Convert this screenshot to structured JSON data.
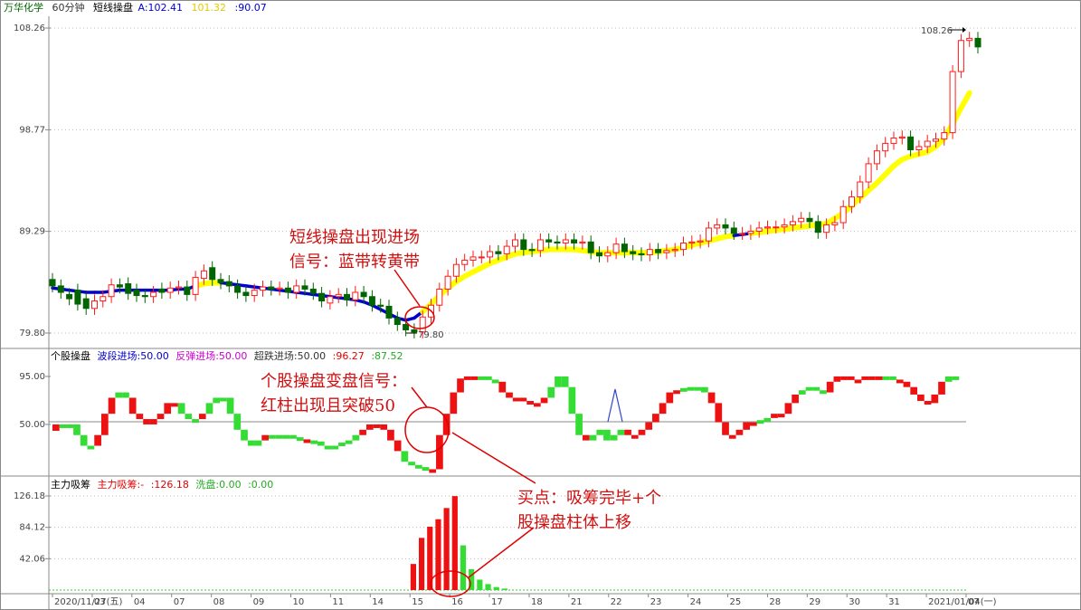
{
  "header": {
    "stock": "万华化学",
    "period": "60分钟",
    "indicator": "短线操盘",
    "a_label": "A:102.41",
    "b_label": "101.32",
    "c_label": ":90.07"
  },
  "panel2_header": {
    "title": "个股操盘",
    "bd": "波段进场:50.00",
    "ft": "反弹进场:50.00",
    "cd": "超跌进场:50.00",
    "v1": ":96.27",
    "v2": ":87.52"
  },
  "panel3_header": {
    "title": "主力吸筹",
    "m1": "主力吸筹:-",
    "m2": ":126.18",
    "wash": "洗盘:0.00",
    "m3": ":0.00"
  },
  "annotations": {
    "a1_line1": "短线操盘出现进场",
    "a1_line2": "信号：蓝带转黄带",
    "a2_line1": "个股操盘变盘信号：",
    "a2_line2": "红柱出现且突破50",
    "a3_line1": "买点：吸筹完毕+个",
    "a3_line2": "股操盘柱体上移"
  },
  "price_markers": {
    "high": "108.26",
    "low": "79.80"
  },
  "colors": {
    "up": "#ff1a1a",
    "down": "#006400",
    "band_up": "#ffff00",
    "band_down": "#0000cc",
    "green_bar": "#33cc33"
  },
  "chart_data": [
    {
      "type": "candlestick",
      "y_ticks": [
        "108.26",
        "98.77",
        "89.29",
        "79.80"
      ],
      "ylim": [
        79.8,
        108.26
      ],
      "x_labels": [
        "2020/11/27(五)",
        "03",
        "04",
        "07",
        "08",
        "09",
        "10",
        "11",
        "14",
        "15",
        "16",
        "17",
        "18",
        "21",
        "22",
        "23",
        "24",
        "25",
        "28",
        "29",
        "30",
        "31",
        "2021/01/04(一)",
        "07"
      ],
      "close": [
        84.2,
        83.6,
        83,
        82.5,
        82.1,
        82.8,
        83.2,
        84.3,
        84.1,
        83.5,
        83.3,
        83.2,
        83.6,
        83.6,
        84,
        84.1,
        83.4,
        85,
        85.6,
        84.8,
        84.5,
        84.2,
        83.6,
        83.3,
        83.8,
        84.1,
        83.9,
        84,
        83.6,
        84.2,
        83.9,
        83.5,
        82.8,
        83.2,
        83.4,
        82.9,
        83.6,
        83.2,
        82.4,
        82.3,
        81.2,
        80.6,
        80.1,
        79.9,
        81.3,
        82.4,
        83.9,
        85.1,
        86.2,
        86.6,
        86.9,
        86.9,
        87.4,
        87.2,
        87.9,
        88.5,
        87.6,
        87.5,
        88.5,
        88.3,
        88.2,
        88.5,
        88.2,
        88.3,
        87.3,
        87.0,
        87.3,
        88.1,
        87.4,
        87.2,
        87.1,
        87.6,
        87.3,
        87.5,
        87.6,
        88.2,
        88.3,
        88.4,
        89.6,
        89.9,
        89.6,
        89.1,
        89.1,
        89.3,
        89.6,
        89.7,
        89.7,
        89.9,
        90.2,
        90.5,
        90.2,
        89.2,
        89.9,
        90.1,
        91.6,
        92.5,
        93.9,
        95.6,
        96.8,
        97.5,
        98.0,
        98.1,
        96.9,
        97.2,
        97.7,
        97.9,
        98.5,
        104.2,
        107.1,
        107.3,
        106.5
      ],
      "open": [
        84.8,
        84.2,
        83.4,
        83.8,
        83,
        82.1,
        82.8,
        83.2,
        84.3,
        84.4,
        83.8,
        83.3,
        83.2,
        83.9,
        83.6,
        84,
        84.1,
        83.4,
        84.9,
        85.9,
        84.8,
        84.6,
        84.2,
        83.6,
        83.3,
        83.8,
        84.1,
        83.9,
        84,
        83.6,
        84.2,
        83.9,
        83.5,
        82.6,
        83.2,
        83.4,
        82.9,
        83.6,
        83.2,
        82.4,
        82.3,
        81.2,
        80.6,
        80.1,
        79.9,
        81.3,
        82.4,
        83.9,
        85.1,
        86.2,
        86.6,
        86.9,
        86.9,
        87.4,
        87.2,
        87.9,
        88.5,
        87.6,
        87.5,
        88.5,
        88.3,
        88.2,
        88.5,
        88.2,
        88.3,
        87.3,
        87.0,
        87.3,
        88.1,
        87.4,
        87.2,
        87.1,
        87.6,
        87.3,
        87.5,
        87.6,
        88.2,
        88.3,
        88.4,
        89.6,
        89.9,
        89.6,
        89.1,
        89.1,
        89.3,
        89.6,
        89.7,
        89.7,
        89.9,
        90.2,
        90.5,
        90.2,
        89.2,
        89.9,
        90.1,
        91.6,
        92.5,
        93.9,
        95.6,
        96.8,
        97.5,
        98.0,
        98.1,
        96.9,
        97.2,
        97.7,
        97.9,
        98.5,
        104.2,
        107.1,
        107.3
      ],
      "band": [
        84,
        83.9,
        83.8,
        83.7,
        83.6,
        83.6,
        83.6,
        83.7,
        83.8,
        83.8,
        83.8,
        83.8,
        83.8,
        83.8,
        83.8,
        83.9,
        83.9,
        84.2,
        84.4,
        84.5,
        84.5,
        84.4,
        84.3,
        84.2,
        84.1,
        84.0,
        83.9,
        83.8,
        83.7,
        83.6,
        83.5,
        83.4,
        83.3,
        83.2,
        83.1,
        83.0,
        82.9,
        82.7,
        82.4,
        82.0,
        81.6,
        81.2,
        81.0,
        81.2,
        81.8,
        82.5,
        83.3,
        84.0,
        84.6,
        85.1,
        85.5,
        85.9,
        86.3,
        86.6,
        86.9,
        87.2,
        87.3,
        87.4,
        87.5,
        87.6,
        87.6,
        87.6,
        87.6,
        87.5,
        87.4,
        87.3,
        87.3,
        87.3,
        87.3,
        87.3,
        87.3,
        87.3,
        87.4,
        87.5,
        87.6,
        87.8,
        88.0,
        88.2,
        88.4,
        88.6,
        88.8,
        88.9,
        89.0,
        89.1,
        89.2,
        89.3,
        89.4,
        89.5,
        89.6,
        89.7,
        89.8,
        89.9,
        90.0,
        90.5,
        91.0,
        91.7,
        92.4,
        93.1,
        93.8,
        94.6,
        95.4,
        96.0,
        96.3,
        96.5,
        96.7,
        97.2,
        98.0,
        99.3,
        100.8,
        102.2
      ],
      "band_color": [
        "d",
        "d",
        "d",
        "d",
        "d",
        "d",
        "d",
        "d",
        "d",
        "d",
        "d",
        "d",
        "d",
        "d",
        "d",
        "d",
        "d",
        "u",
        "u",
        "u",
        "d",
        "d",
        "d",
        "d",
        "d",
        "d",
        "d",
        "d",
        "d",
        "d",
        "d",
        "d",
        "d",
        "d",
        "d",
        "d",
        "d",
        "d",
        "d",
        "d",
        "d",
        "d",
        "d",
        "d",
        "u",
        "u",
        "u",
        "u",
        "u",
        "u",
        "u",
        "u",
        "u",
        "u",
        "u",
        "u",
        "u",
        "u",
        "u",
        "u",
        "u",
        "u",
        "u",
        "u",
        "u",
        "u",
        "u",
        "u",
        "u",
        "u",
        "u",
        "u",
        "u",
        "u",
        "u",
        "u",
        "u",
        "u",
        "u",
        "u",
        "u",
        "d",
        "d",
        "u",
        "u",
        "u",
        "u",
        "u",
        "u",
        "u",
        "u",
        "u",
        "u",
        "u",
        "u",
        "u",
        "u",
        "u",
        "u",
        "u",
        "u",
        "u",
        "u",
        "u",
        "u",
        "u",
        "u",
        "u",
        "u",
        "u",
        "u"
      ]
    },
    {
      "type": "bar",
      "y_ticks": [
        "95.00",
        "50.00"
      ],
      "ylim": [
        5,
        100
      ],
      "values": [
        44,
        50,
        50,
        50,
        40,
        30,
        30,
        40,
        60,
        75,
        80,
        75,
        60,
        55,
        50,
        55,
        60,
        70,
        70,
        60,
        55,
        55,
        60,
        70,
        75,
        75,
        60,
        45,
        35,
        30,
        35,
        40,
        40,
        40,
        40,
        38,
        36,
        35,
        34,
        30,
        28,
        30,
        33,
        35,
        40,
        45,
        50,
        50,
        45,
        35,
        25,
        15,
        12,
        10,
        8,
        8,
        40,
        60,
        80,
        93,
        95,
        95,
        95,
        92,
        90,
        80,
        75,
        75,
        72,
        70,
        70,
        75,
        85,
        95,
        85,
        60,
        40,
        35,
        40,
        45,
        35,
        40,
        45,
        40,
        40,
        45,
        52,
        60,
        70,
        80,
        82,
        84,
        85,
        85,
        80,
        70,
        52,
        40,
        40,
        45,
        52,
        52,
        54,
        56,
        60,
        60,
        70,
        78,
        82,
        85,
        82,
        80,
        90,
        95,
        95,
        92,
        92,
        95,
        95,
        95,
        95,
        92,
        90,
        85,
        78,
        72,
        70,
        78,
        90,
        95,
        95
      ],
      "color": [
        "r",
        "g",
        "g",
        "g",
        "g",
        "g",
        "r",
        "r",
        "r",
        "g",
        "g",
        "r",
        "r",
        "r",
        "r",
        "r",
        "r",
        "r",
        "g",
        "g",
        "g",
        "r",
        "g",
        "g",
        "g",
        "g",
        "g",
        "g",
        "g",
        "g",
        "r",
        "g",
        "g",
        "g",
        "g",
        "g",
        "r",
        "g",
        "g",
        "g",
        "g",
        "g",
        "g",
        "g",
        "r",
        "r",
        "r",
        "r",
        "r",
        "r",
        "g",
        "g",
        "g",
        "g",
        "r",
        "r",
        "r",
        "r",
        "r",
        "r",
        "r",
        "g",
        "g",
        "g",
        "r",
        "r",
        "r",
        "r",
        "r",
        "r",
        "r",
        "g",
        "g",
        "g",
        "g",
        "g",
        "r",
        "g",
        "g",
        "g",
        "g",
        "g",
        "r",
        "r",
        "r",
        "r",
        "r",
        "r",
        "r",
        "r",
        "g",
        "g",
        "g",
        "g",
        "r",
        "r",
        "r",
        "r",
        "r",
        "r",
        "r",
        "g",
        "g",
        "r",
        "r",
        "r",
        "r",
        "g",
        "g",
        "g",
        "g",
        "r",
        "r",
        "r",
        "r",
        "r",
        "r",
        "r",
        "r",
        "g",
        "g",
        "r",
        "r",
        "r",
        "r",
        "r",
        "r",
        "r"
      ]
    },
    {
      "type": "bar",
      "y_ticks": [
        "126.18",
        "84.12",
        "42.06"
      ],
      "ylim": [
        0,
        126.18
      ],
      "values": [
        0,
        0,
        0,
        0,
        0,
        0,
        0,
        0,
        0,
        0,
        0,
        0,
        0,
        0,
        0,
        0,
        0,
        0,
        0,
        0,
        0,
        0,
        0,
        0,
        0,
        0,
        0,
        0,
        0,
        0,
        0,
        0,
        0,
        0,
        0,
        0,
        0,
        0,
        0,
        0,
        0,
        0,
        0,
        35,
        70,
        85,
        95,
        110,
        126,
        60,
        28,
        14,
        8,
        4,
        2,
        0,
        0,
        0,
        0,
        0,
        0,
        0,
        0,
        0,
        0,
        0,
        0,
        0,
        0,
        0,
        0,
        0,
        0,
        0,
        0,
        0,
        0,
        0,
        0,
        0,
        0,
        0,
        0,
        0,
        0,
        0,
        0,
        0,
        0,
        0,
        0,
        0,
        0,
        0,
        0,
        0,
        0,
        0,
        0,
        0,
        0,
        0,
        0,
        0,
        0,
        0,
        0,
        0,
        0,
        0
      ],
      "color": [
        "g",
        "g",
        "g",
        "g",
        "g",
        "g",
        "g",
        "g",
        "g",
        "g",
        "g",
        "g",
        "g",
        "g",
        "g",
        "g",
        "g",
        "g",
        "g",
        "g",
        "g",
        "g",
        "g",
        "g",
        "g",
        "g",
        "g",
        "g",
        "g",
        "g",
        "g",
        "g",
        "g",
        "g",
        "g",
        "g",
        "g",
        "g",
        "g",
        "g",
        "g",
        "g",
        "g",
        "r",
        "r",
        "r",
        "r",
        "r",
        "r",
        "g",
        "g",
        "g",
        "g",
        "g",
        "g",
        "g",
        "g",
        "g",
        "g",
        "g",
        "g",
        "g",
        "g",
        "g",
        "g",
        "g",
        "g",
        "g",
        "g",
        "g",
        "g",
        "g",
        "g",
        "g",
        "g",
        "g",
        "g",
        "g",
        "g",
        "g",
        "g",
        "g",
        "g",
        "g",
        "g",
        "g",
        "g",
        "g",
        "g",
        "g",
        "g",
        "g",
        "g",
        "g",
        "g",
        "g",
        "g",
        "g",
        "g",
        "g",
        "g",
        "g",
        "g",
        "g",
        "g",
        "g",
        "g",
        "g",
        "g",
        "g"
      ]
    }
  ]
}
